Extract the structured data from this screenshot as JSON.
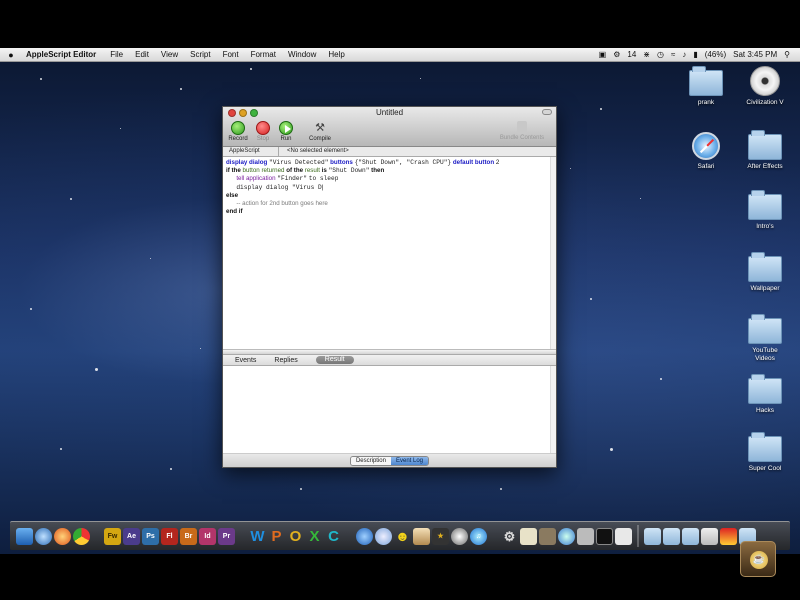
{
  "menubar": {
    "apple_glyph": "",
    "app_name": "AppleScript Editor",
    "items": [
      "File",
      "Edit",
      "View",
      "Script",
      "Font",
      "Format",
      "Window",
      "Help"
    ],
    "status": {
      "battery": "(46%)",
      "clock": "Sat 3:45 PM",
      "extra": "14"
    }
  },
  "window": {
    "title": "Untitled",
    "toolbar": {
      "record": "Record",
      "stop": "Stop",
      "run": "Run",
      "compile": "Compile",
      "bundle": "Bundle Contents"
    },
    "navbar": {
      "language": "AppleScript",
      "element": "<No selected element>"
    },
    "code": {
      "l1_kw": "display dialog",
      "l1_str": "\"Virus Detected\"",
      "l1_kw2": "buttons",
      "l1_list": "{\"Shut Down\", \"Crash CPU\"}",
      "l1_kw3": "default button",
      "l1_num": "2",
      "l2_if": "if the",
      "l2_var": "button returned",
      "l2_of": "of the",
      "l2_res": "result",
      "l2_is": "is",
      "l2_str": "\"Shut Down\"",
      "l2_then": "then",
      "l3_tell": "tell application",
      "l3_app": "\"Finder\"",
      "l3_to": "to sleep",
      "l4": "display dialog \"Virus D",
      "l5": "else",
      "l6": "-- action for 2nd button goes here",
      "l7": "end if"
    },
    "tabs": {
      "events": "Events",
      "replies": "Replies",
      "result": "Result"
    },
    "bottom": {
      "description": "Description",
      "event_log": "Event Log"
    }
  },
  "desktop_icons": [
    {
      "name": "prank",
      "type": "folder"
    },
    {
      "name": "Civilization V",
      "type": "disc"
    },
    {
      "name": "Safari",
      "type": "safari"
    },
    {
      "name": "After Effects",
      "type": "folder"
    },
    {
      "name": "Intro's",
      "type": "folder"
    },
    {
      "name": "Wallpaper",
      "type": "folder"
    },
    {
      "name": "YouTube Videos",
      "type": "folder"
    },
    {
      "name": "Hacks",
      "type": "folder"
    },
    {
      "name": "Super Cool",
      "type": "folder"
    }
  ],
  "dock": {
    "letters": [
      "W",
      "P",
      "O",
      "X",
      "C"
    ],
    "adobe": [
      "Fw",
      "Ae",
      "Ps",
      "Fl",
      "Br",
      "Id",
      "Pr"
    ]
  },
  "colors": {
    "keyword": "#1b1bc4",
    "comment": "#7a7a7a",
    "application_class": "#7a1f9e",
    "variable": "#3a6a1a",
    "selected_segment": "#4d86cf"
  }
}
